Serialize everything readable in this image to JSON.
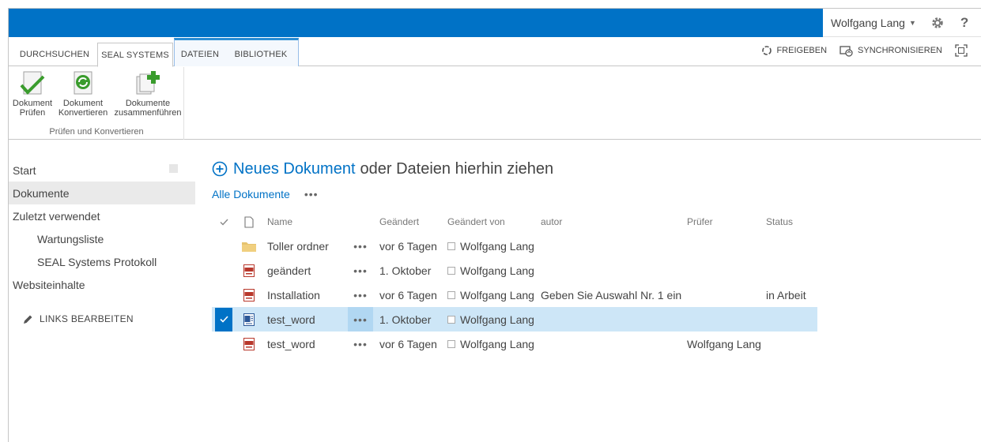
{
  "suitebar": {
    "user_name": "Wolfgang Lang",
    "help_label": "?"
  },
  "ribbon": {
    "tabs": [
      {
        "label": "DURCHSUCHEN"
      },
      {
        "label": "SEAL SYSTEMS"
      },
      {
        "label": "DATEIEN"
      },
      {
        "label": "BIBLIOTHEK"
      }
    ],
    "share_label": "FREIGEBEN",
    "sync_label": "SYNCHRONISIEREN",
    "group_label": "Prüfen und Konvertieren",
    "buttons": [
      {
        "line1": "Dokument",
        "line2": "Prüfen"
      },
      {
        "line1": "Dokument",
        "line2": "Konvertieren"
      },
      {
        "line1": "Dokumente",
        "line2": "zusammenführen"
      }
    ]
  },
  "leftnav": {
    "items": [
      {
        "label": "Start"
      },
      {
        "label": "Dokumente"
      },
      {
        "label": "Zuletzt verwendet"
      },
      {
        "label": "Wartungsliste"
      },
      {
        "label": "SEAL Systems Protokoll"
      },
      {
        "label": "Websiteinhalte"
      }
    ],
    "edit_links": "LINKS BEARBEITEN"
  },
  "main": {
    "new_doc_link": "Neues Dokument",
    "new_doc_rest": "oder Dateien hierhin ziehen",
    "view_name": "Alle Dokumente",
    "view_more": "•••",
    "columns": {
      "name": "Name",
      "modified": "Geändert",
      "modified_by": "Geändert von",
      "autor": "autor",
      "pruefer": "Prüfer",
      "status": "Status"
    },
    "rows": [
      {
        "type": "folder",
        "name": "Toller ordner",
        "menu": "•••",
        "modified": "vor 6 Tagen",
        "modified_by": "Wolfgang Lang",
        "autor": "",
        "pruefer": "",
        "status": ""
      },
      {
        "type": "pdf",
        "name": "geändert",
        "menu": "•••",
        "modified": "1. Oktober",
        "modified_by": "Wolfgang Lang",
        "autor": "",
        "pruefer": "",
        "status": ""
      },
      {
        "type": "pdf",
        "name": "Installation",
        "menu": "•••",
        "modified": "vor 6 Tagen",
        "modified_by": "Wolfgang Lang",
        "autor": "Geben Sie Auswahl Nr. 1 ein",
        "pruefer": "",
        "status": "in Arbeit"
      },
      {
        "type": "word",
        "name": "test_word",
        "menu": "•••",
        "modified": "1. Oktober",
        "modified_by": "Wolfgang Lang",
        "autor": "",
        "pruefer": "",
        "status": ""
      },
      {
        "type": "pdf",
        "name": "test_word",
        "menu": "•••",
        "modified": "vor 6 Tagen",
        "modified_by": "Wolfgang Lang",
        "autor": "",
        "pruefer": "Wolfgang Lang",
        "status": ""
      }
    ]
  },
  "colors": {
    "suitebar": "#0072c6",
    "link": "#0072c6",
    "selected_row": "#cde6f7"
  }
}
